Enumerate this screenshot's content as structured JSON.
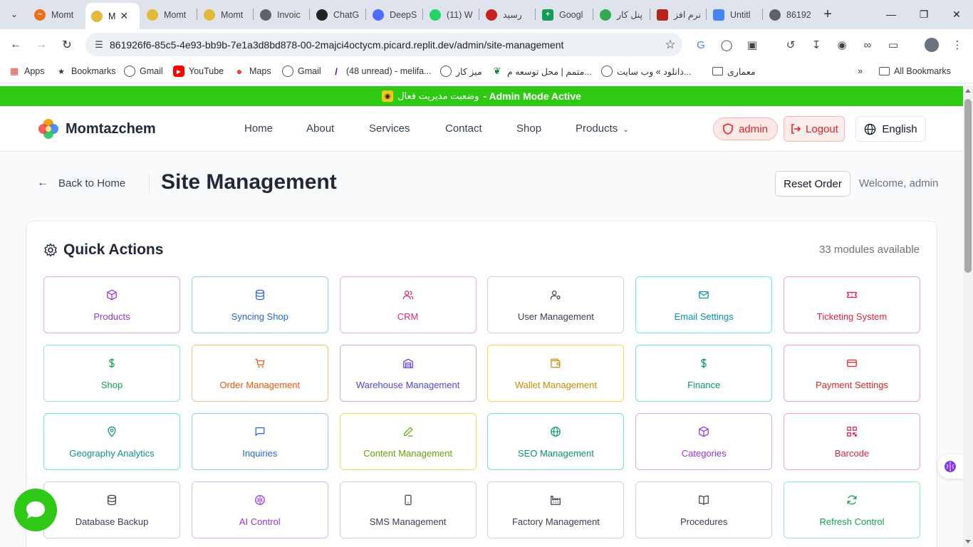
{
  "browser": {
    "tabs": [
      {
        "title": "Momt",
        "color": "#e8711a"
      },
      {
        "title": "M",
        "color": "#e2b93b",
        "active": true
      },
      {
        "title": "Momt",
        "color": "#e2b93b"
      },
      {
        "title": "Momt",
        "color": "#e2b93b"
      },
      {
        "title": "Invoic",
        "color": "#5f6368"
      },
      {
        "title": "ChatG",
        "color": "#222222"
      },
      {
        "title": "DeepS",
        "color": "#4d6bfe"
      },
      {
        "title": "(11) W",
        "color": "#25d366"
      },
      {
        "title": "رسید",
        "color": "#c5221f"
      },
      {
        "title": "Googl",
        "color": "#0f9d58"
      },
      {
        "title": "پنل کار",
        "color": "#34a853"
      },
      {
        "title": "نرم افز",
        "color": "#b3261e"
      },
      {
        "title": "Untitl",
        "color": "#4285f4"
      },
      {
        "title": "86192",
        "color": "#5f6368"
      }
    ],
    "url": "861926f6-85c5-4e93-bb9b-7e1a3d8bd878-00-2majci4octycm.picard.replit.dev/admin/site-management",
    "bookmarks": [
      {
        "label": "Apps",
        "icon": "apps-grid-icon"
      },
      {
        "label": "Bookmarks",
        "icon": "star-icon"
      },
      {
        "label": "Gmail",
        "icon": "globe-icon"
      },
      {
        "label": "YouTube",
        "icon": "youtube-icon"
      },
      {
        "label": "Maps",
        "icon": "maps-pin-icon"
      },
      {
        "label": "Gmail",
        "icon": "globe-icon"
      },
      {
        "label": "(48 unread) - melifa...",
        "icon": "yahoo-icon"
      },
      {
        "label": "میز کار",
        "icon": "globe-icon"
      },
      {
        "label": "متمم | محل توسعه م...",
        "icon": "leaf-icon"
      },
      {
        "label": "دانلود » وب سایت...",
        "icon": "globe-icon"
      },
      {
        "label": "معماری",
        "icon": "folder-icon"
      }
    ],
    "all_bookmarks": "All Bookmarks"
  },
  "admin_banner": {
    "text_fa": "وضعیت مدیریت فعال",
    "text_en": "- Admin Mode Active"
  },
  "header": {
    "brand": "Momtazchem",
    "nav": [
      "Home",
      "About",
      "Services",
      "Contact",
      "Shop",
      "Products"
    ],
    "admin_badge": "admin",
    "logout": "Logout",
    "language": "English"
  },
  "page": {
    "back_label": "Back to Home",
    "title": "Site Management",
    "reset_order": "Reset Order",
    "welcome": "Welcome, admin"
  },
  "quick_actions": {
    "title": "Quick Actions",
    "count_text": "33 modules available",
    "tiles": [
      {
        "label": "Products",
        "icon": "box-icon",
        "color": "#9333ea",
        "border": "#e9a8e0"
      },
      {
        "label": "Syncing Shop",
        "icon": "database-icon",
        "color": "#2563eb",
        "border": "#93c5fd"
      },
      {
        "label": "CRM",
        "icon": "users-icon",
        "color": "#db2777",
        "border": "#f9a8d4"
      },
      {
        "label": "User Management",
        "icon": "user-cog-icon",
        "color": "#374151",
        "border": "#d1d5db"
      },
      {
        "label": "Email Settings",
        "icon": "mail-icon",
        "color": "#0891b2",
        "border": "#67e8f9"
      },
      {
        "label": "Ticketing System",
        "icon": "ticket-icon",
        "color": "#e11d48",
        "border": "#fda4af"
      },
      {
        "label": "Shop",
        "icon": "dollar-icon",
        "color": "#16a34a",
        "border": "#86efac"
      },
      {
        "label": "Order Management",
        "icon": "cart-icon",
        "color": "#ea580c",
        "border": "#fdba74"
      },
      {
        "label": "Warehouse Management",
        "icon": "warehouse-icon",
        "color": "#4f46e5",
        "border": "#a5b4fc"
      },
      {
        "label": "Wallet Management",
        "icon": "wallet-icon",
        "color": "#ca8a04",
        "border": "#fcd34d"
      },
      {
        "label": "Finance",
        "icon": "dollar-icon",
        "color": "#059669",
        "border": "#6ee7b7"
      },
      {
        "label": "Payment Settings",
        "icon": "credit-card-icon",
        "color": "#dc2626",
        "border": "#fca5a5"
      },
      {
        "label": "Geography Analytics",
        "icon": "map-pin-icon",
        "color": "#0d9488",
        "border": "#5eead4"
      },
      {
        "label": "Inquiries",
        "icon": "message-square-icon",
        "color": "#2563eb",
        "border": "#93c5fd"
      },
      {
        "label": "Content Management",
        "icon": "pen-icon",
        "color": "#65a30d",
        "border": "#bef264"
      },
      {
        "label": "SEO Management",
        "icon": "globe-icon",
        "color": "#059669",
        "border": "#6ee7b7"
      },
      {
        "label": "Categories",
        "icon": "box-icon",
        "color": "#9333ea",
        "border": "#c4b5fd"
      },
      {
        "label": "Barcode",
        "icon": "qr-code-icon",
        "color": "#e11d48",
        "border": "#fda4af"
      },
      {
        "label": "Database Backup",
        "icon": "database-icon",
        "color": "#374151",
        "border": "#d1d5db"
      },
      {
        "label": "AI Control",
        "icon": "brain-icon",
        "color": "#9333ea",
        "border": "#d8b4fe"
      },
      {
        "label": "SMS Management",
        "icon": "smartphone-icon",
        "color": "#374151",
        "border": "#d1d5db"
      },
      {
        "label": "Factory Management",
        "icon": "factory-icon",
        "color": "#374151",
        "border": "#d1d5db"
      },
      {
        "label": "Procedures",
        "icon": "book-open-icon",
        "color": "#374151",
        "border": "#d1d5db"
      },
      {
        "label": "Refresh Control",
        "icon": "refresh-icon",
        "color": "#16a34a",
        "border": "#86efac"
      }
    ]
  }
}
